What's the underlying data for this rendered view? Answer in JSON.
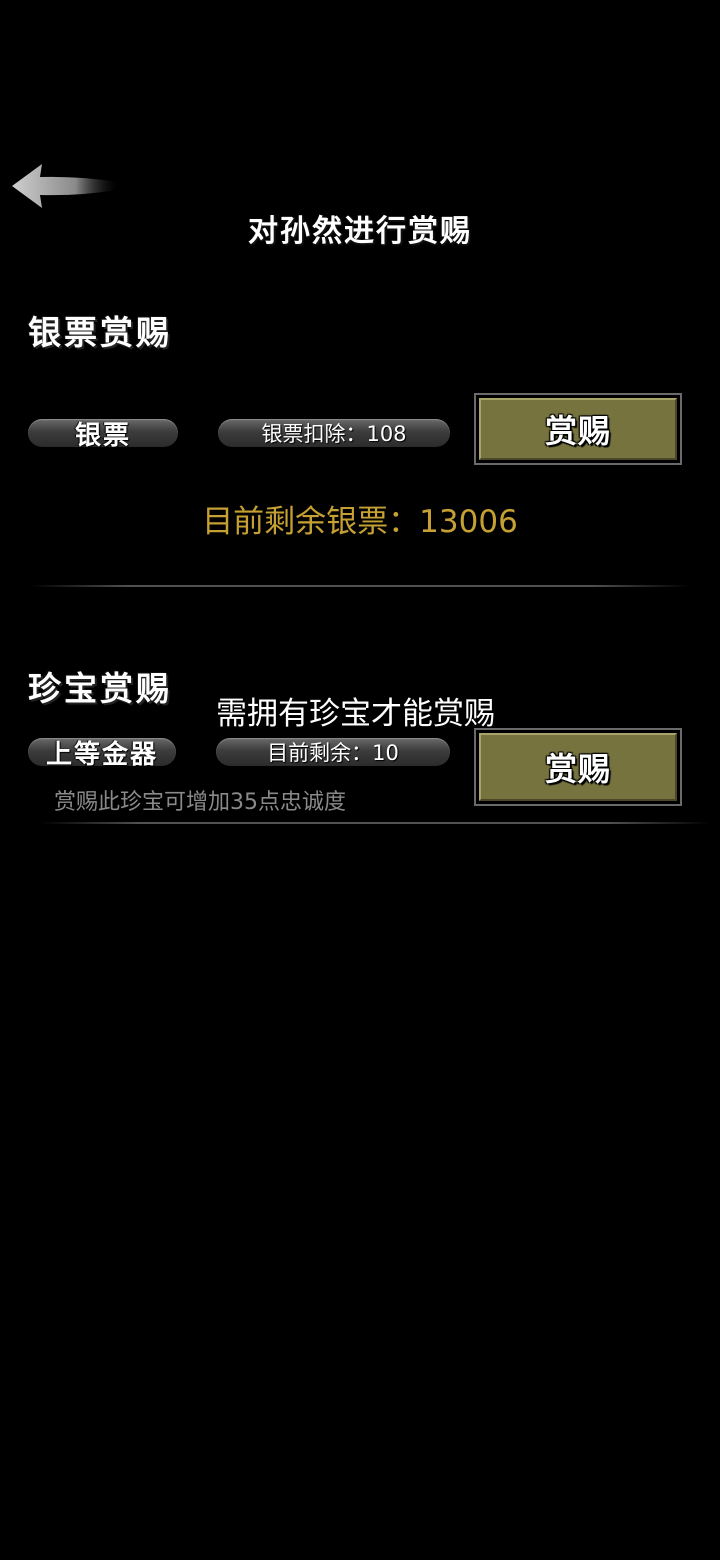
{
  "header": {
    "title": "对孙然进行赏赐",
    "back_icon": "back-arrow-icon"
  },
  "silver_section": {
    "title": "银票赏赐",
    "item_label": "银票",
    "deduct_text": "银票扣除：108",
    "reward_label": "赏赐",
    "remaining_text": "目前剩余银票：13006"
  },
  "treasure_section": {
    "title": "珍宝赏赐",
    "need_text": "需拥有珍宝才能赏赐",
    "item_label": "上等金器",
    "remaining_text": "目前剩余：10",
    "reward_label": "赏赐",
    "hint_text": "赏赐此珍宝可增加35点忠诚度"
  },
  "colors": {
    "background": "#000000",
    "button_face": "#76733f",
    "highlight_text": "#c5a033",
    "hint_text": "#8a8a8a"
  }
}
